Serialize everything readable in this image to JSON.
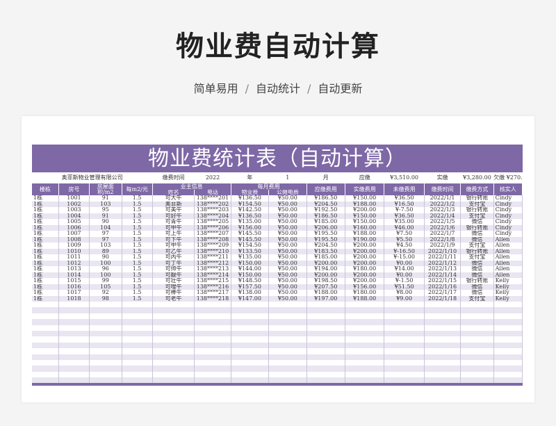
{
  "page": {
    "title": "物业费自动计算",
    "subtitle_items": [
      "简单易用",
      "自动统计",
      "自动更新"
    ],
    "subtitle_sep": "/"
  },
  "sheet": {
    "banner": "物业费统计表（自动计算）",
    "meta": {
      "company": "奥菲斯物业管理有限公司",
      "time_label": "缴费时间",
      "year": "2022",
      "year_unit": "年",
      "month": "1",
      "month_unit": "月",
      "due_label": "应缴",
      "due_value": "¥3,510.00",
      "paid_label": "实缴",
      "paid_value": "¥3,280.00",
      "owe_label": "欠缴",
      "owe_value": "¥270.50"
    },
    "headers": {
      "building": "楼栋",
      "room": "房号",
      "area": "房屋面积/m2",
      "price": "每m2/元",
      "owner_group": "业主信息",
      "name": "姓名",
      "phone": "电话",
      "monthly_group": "每月费用",
      "property_fee": "物业费",
      "shared_fee": "公摊电费",
      "due": "应缴费用",
      "paid": "实缴费用",
      "unpaid": "未缴费用",
      "pay_time": "缴费时间",
      "pay_method": "缴费方式",
      "checker": "核实人"
    },
    "rows": [
      [
        "1栋",
        "1001",
        "91",
        "1.5",
        "可大牛",
        "138****201",
        "¥136.50",
        "¥50.00",
        "¥186.50",
        "¥150.00",
        "¥36.50",
        "2022/1/1",
        "银行转账",
        "Cindy"
      ],
      [
        "1栋",
        "1002",
        "103",
        "1.5",
        "奥菲斯",
        "138****202",
        "¥154.50",
        "¥50.00",
        "¥204.50",
        "¥188.00",
        "¥16.50",
        "2022/1/2",
        "支付宝",
        "Cindy"
      ],
      [
        "1栋",
        "1003",
        "95",
        "1.5",
        "可美牛",
        "138****203",
        "¥142.50",
        "¥50.00",
        "¥192.50",
        "¥200.00",
        "¥-7.50",
        "2022/1/3",
        "银行转账",
        "Cindy"
      ],
      [
        "1栋",
        "1004",
        "91",
        "1.5",
        "可好牛",
        "138****204",
        "¥136.50",
        "¥50.00",
        "¥186.50",
        "¥150.00",
        "¥36.50",
        "2022/1/4",
        "支付宝",
        "Cindy"
      ],
      [
        "1栋",
        "1005",
        "90",
        "1.5",
        "可青牛",
        "138****205",
        "¥135.00",
        "¥50.00",
        "¥185.00",
        "¥150.00",
        "¥35.00",
        "2022/1/5",
        "微信",
        "Cindy"
      ],
      [
        "1栋",
        "1006",
        "104",
        "1.5",
        "可甲牛",
        "138****206",
        "¥156.00",
        "¥50.00",
        "¥206.00",
        "¥160.00",
        "¥46.00",
        "2022/1/6",
        "银行转账",
        "Cindy"
      ],
      [
        "1栋",
        "1007",
        "97",
        "1.5",
        "可上牛",
        "138****207",
        "¥145.50",
        "¥50.00",
        "¥195.50",
        "¥188.00",
        "¥7.50",
        "2022/1/7",
        "微信",
        "Cindy"
      ],
      [
        "1栋",
        "1008",
        "97",
        "1.5",
        "可下牛",
        "138****208",
        "¥145.50",
        "¥50.00",
        "¥195.50",
        "¥190.00",
        "¥5.50",
        "2022/1/8",
        "微信",
        "Allen"
      ],
      [
        "1栋",
        "1009",
        "103",
        "1.5",
        "可甲牛",
        "138****209",
        "¥154.50",
        "¥50.00",
        "¥204.50",
        "¥200.00",
        "¥4.50",
        "2022/1/9",
        "支付宝",
        "Allen"
      ],
      [
        "1栋",
        "1010",
        "89",
        "1.5",
        "可乙牛",
        "138****210",
        "¥133.50",
        "¥50.00",
        "¥183.50",
        "¥200.00",
        "¥-16.50",
        "2022/1/10",
        "银行转账",
        "Allen"
      ],
      [
        "1栋",
        "1011",
        "90",
        "1.5",
        "可丙牛",
        "138****211",
        "¥135.00",
        "¥50.00",
        "¥185.00",
        "¥200.00",
        "¥-15.00",
        "2022/1/11",
        "支付宝",
        "Allen"
      ],
      [
        "1栋",
        "1012",
        "100",
        "1.5",
        "可丁牛",
        "138****212",
        "¥150.00",
        "¥50.00",
        "¥200.00",
        "¥200.00",
        "¥0.00",
        "2022/1/12",
        "微信",
        "Allen"
      ],
      [
        "1栋",
        "1013",
        "96",
        "1.5",
        "可帅牛",
        "138****213",
        "¥144.00",
        "¥50.00",
        "¥194.00",
        "¥180.00",
        "¥14.00",
        "2022/1/13",
        "微信",
        "Allen"
      ],
      [
        "1栋",
        "1014",
        "100",
        "1.5",
        "可靓牛",
        "138****214",
        "¥150.00",
        "¥50.00",
        "¥200.00",
        "¥200.00",
        "¥0.00",
        "2022/1/14",
        "微信",
        "Allen"
      ],
      [
        "1栋",
        "1015",
        "99",
        "1.5",
        "可壮牛",
        "138****215",
        "¥148.50",
        "¥50.00",
        "¥198.50",
        "¥200.00",
        "¥-1.50",
        "2022/1/15",
        "银行转账",
        "Kelly"
      ],
      [
        "1栋",
        "1016",
        "105",
        "1.5",
        "可嗖牛",
        "138****216",
        "¥157.50",
        "¥50.00",
        "¥207.50",
        "¥156.00",
        "¥51.50",
        "2022/1/16",
        "微信",
        "Kelly"
      ],
      [
        "1栋",
        "1017",
        "92",
        "1.5",
        "可棒牛",
        "138****217",
        "¥138.00",
        "¥50.00",
        "¥188.00",
        "¥180.00",
        "¥8.00",
        "2022/1/17",
        "微信",
        "Kelly"
      ],
      [
        "1栋",
        "1018",
        "98",
        "1.5",
        "可老牛",
        "138****218",
        "¥147.00",
        "¥50.00",
        "¥197.00",
        "¥188.00",
        "¥9.00",
        "2022/1/18",
        "支付宝",
        "Kelly"
      ]
    ]
  }
}
